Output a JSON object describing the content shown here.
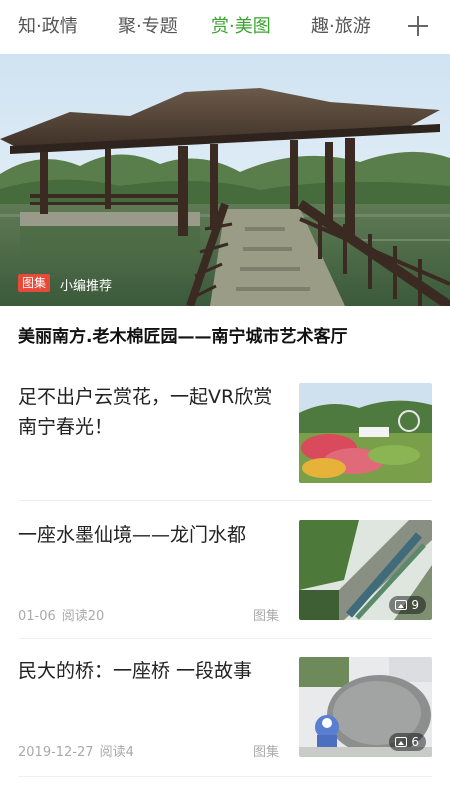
{
  "tabs": [
    {
      "label": "知·政情",
      "active": false
    },
    {
      "label": "聚·专题",
      "active": false
    },
    {
      "label": "赏·美图",
      "active": true
    },
    {
      "label": "趣·旅游",
      "active": false
    }
  ],
  "add_icon": "plus-icon",
  "hero": {
    "tag": "图集",
    "subtitle": "小编推荐",
    "title": "美丽南方.老木棉匠园——南宁城市艺术客厅"
  },
  "articles": [
    {
      "title": "足不出户云赏花，一起VR欣赏南宁春光！"
    },
    {
      "title": "一座水墨仙境——龙门水都",
      "date": "01-06",
      "reads": "阅读20",
      "type": "图集",
      "image_count": "9"
    },
    {
      "title": "民大的桥：一座桥 一段故事",
      "date": "2019-12-27",
      "reads": "阅读4",
      "type": "图集",
      "image_count": "6"
    }
  ],
  "colors": {
    "accent": "#3aa42f",
    "tag_red": "#e84a3a"
  }
}
